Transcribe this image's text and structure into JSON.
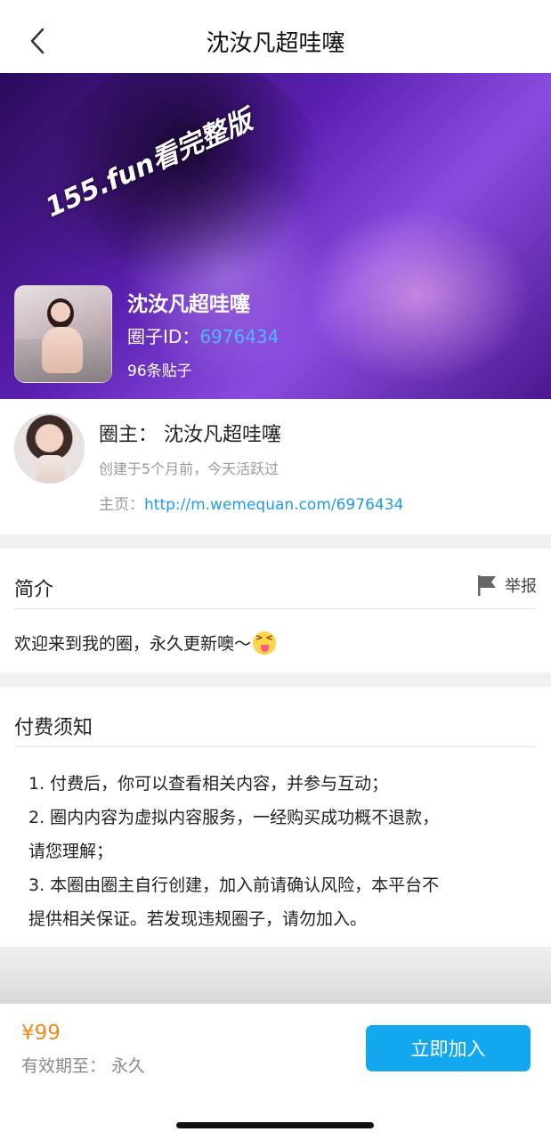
{
  "nav": {
    "back_icon": "chevron-left-icon",
    "title": "沈汝凡超哇噻"
  },
  "hero": {
    "watermark": "155.fun看完整版",
    "title": "沈汝凡超哇噻",
    "id_label": "圈子ID：",
    "id_value": "6976434",
    "posts": "96条贴子"
  },
  "owner": {
    "name": "圈主：  沈汝凡超哇噻",
    "created": "创建于5个月前，今天活跃过",
    "home_label": "主页：",
    "home_link": "http://m.wemequan.com/6976434"
  },
  "intro": {
    "title": "简介",
    "report_icon": "flag-icon",
    "report_label": "举报",
    "text": "欢迎来到我的圈，永久更新噢～",
    "emoji": "squinting-tongue-emoji"
  },
  "notice": {
    "title": "付费须知",
    "lines": [
      "1. 付费后，你可以查看相关内容，并参与互动；",
      "2. 圈内内容为虚拟内容服务，一经购买成功概不退款，",
      "请您理解；",
      "3. 本圈由圈主自行创建，加入前请确认风险，本平台不",
      "提供相关保证。若发现违规圈子，请勿加入。"
    ]
  },
  "purchase": {
    "price": "¥99",
    "validity": "有效期至：  永久",
    "join_label": "立即加入"
  },
  "colors": {
    "accent": "#12a7ef",
    "link": "#1e9be8",
    "price": "#f08a1c",
    "hero_purple": "#5a1fb0"
  }
}
